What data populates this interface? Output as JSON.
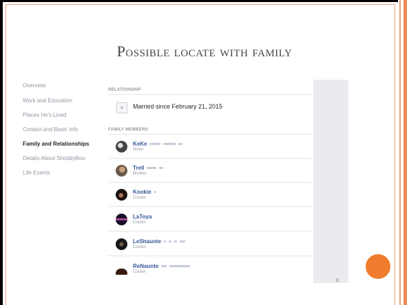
{
  "slide": {
    "title": "Possible locate with family",
    "accent_color": "#f07c2d",
    "frame_color": "#e8a07a"
  },
  "profile_nav": {
    "items": [
      {
        "label": "Overview",
        "active": false
      },
      {
        "label": "Work and Education",
        "active": false
      },
      {
        "label": "Places He's Lived",
        "active": false
      },
      {
        "label": "Contact and Basic Info",
        "active": false
      },
      {
        "label": "Family and Relationships",
        "active": true
      },
      {
        "label": "Details About ShoddyBoo",
        "active": false
      },
      {
        "label": "Life Events",
        "active": false
      }
    ]
  },
  "relationship": {
    "heading": "RELATIONSHIP",
    "icon": "heart-icon",
    "status": "Married since February 21, 2015"
  },
  "family": {
    "heading": "FAMILY MEMBERS",
    "members": [
      {
        "name": "KeKe",
        "relation": "Sister"
      },
      {
        "name": "Trell",
        "relation": "Brother"
      },
      {
        "name": "Kookie",
        "relation": "Cousin"
      },
      {
        "name": "LaToya",
        "relation": "Cousin"
      },
      {
        "name": "LeShaunte",
        "relation": "Cousin"
      },
      {
        "name": "ReNaunte",
        "relation": "Cousin"
      }
    ]
  },
  "side_panel": {
    "text": "C"
  }
}
